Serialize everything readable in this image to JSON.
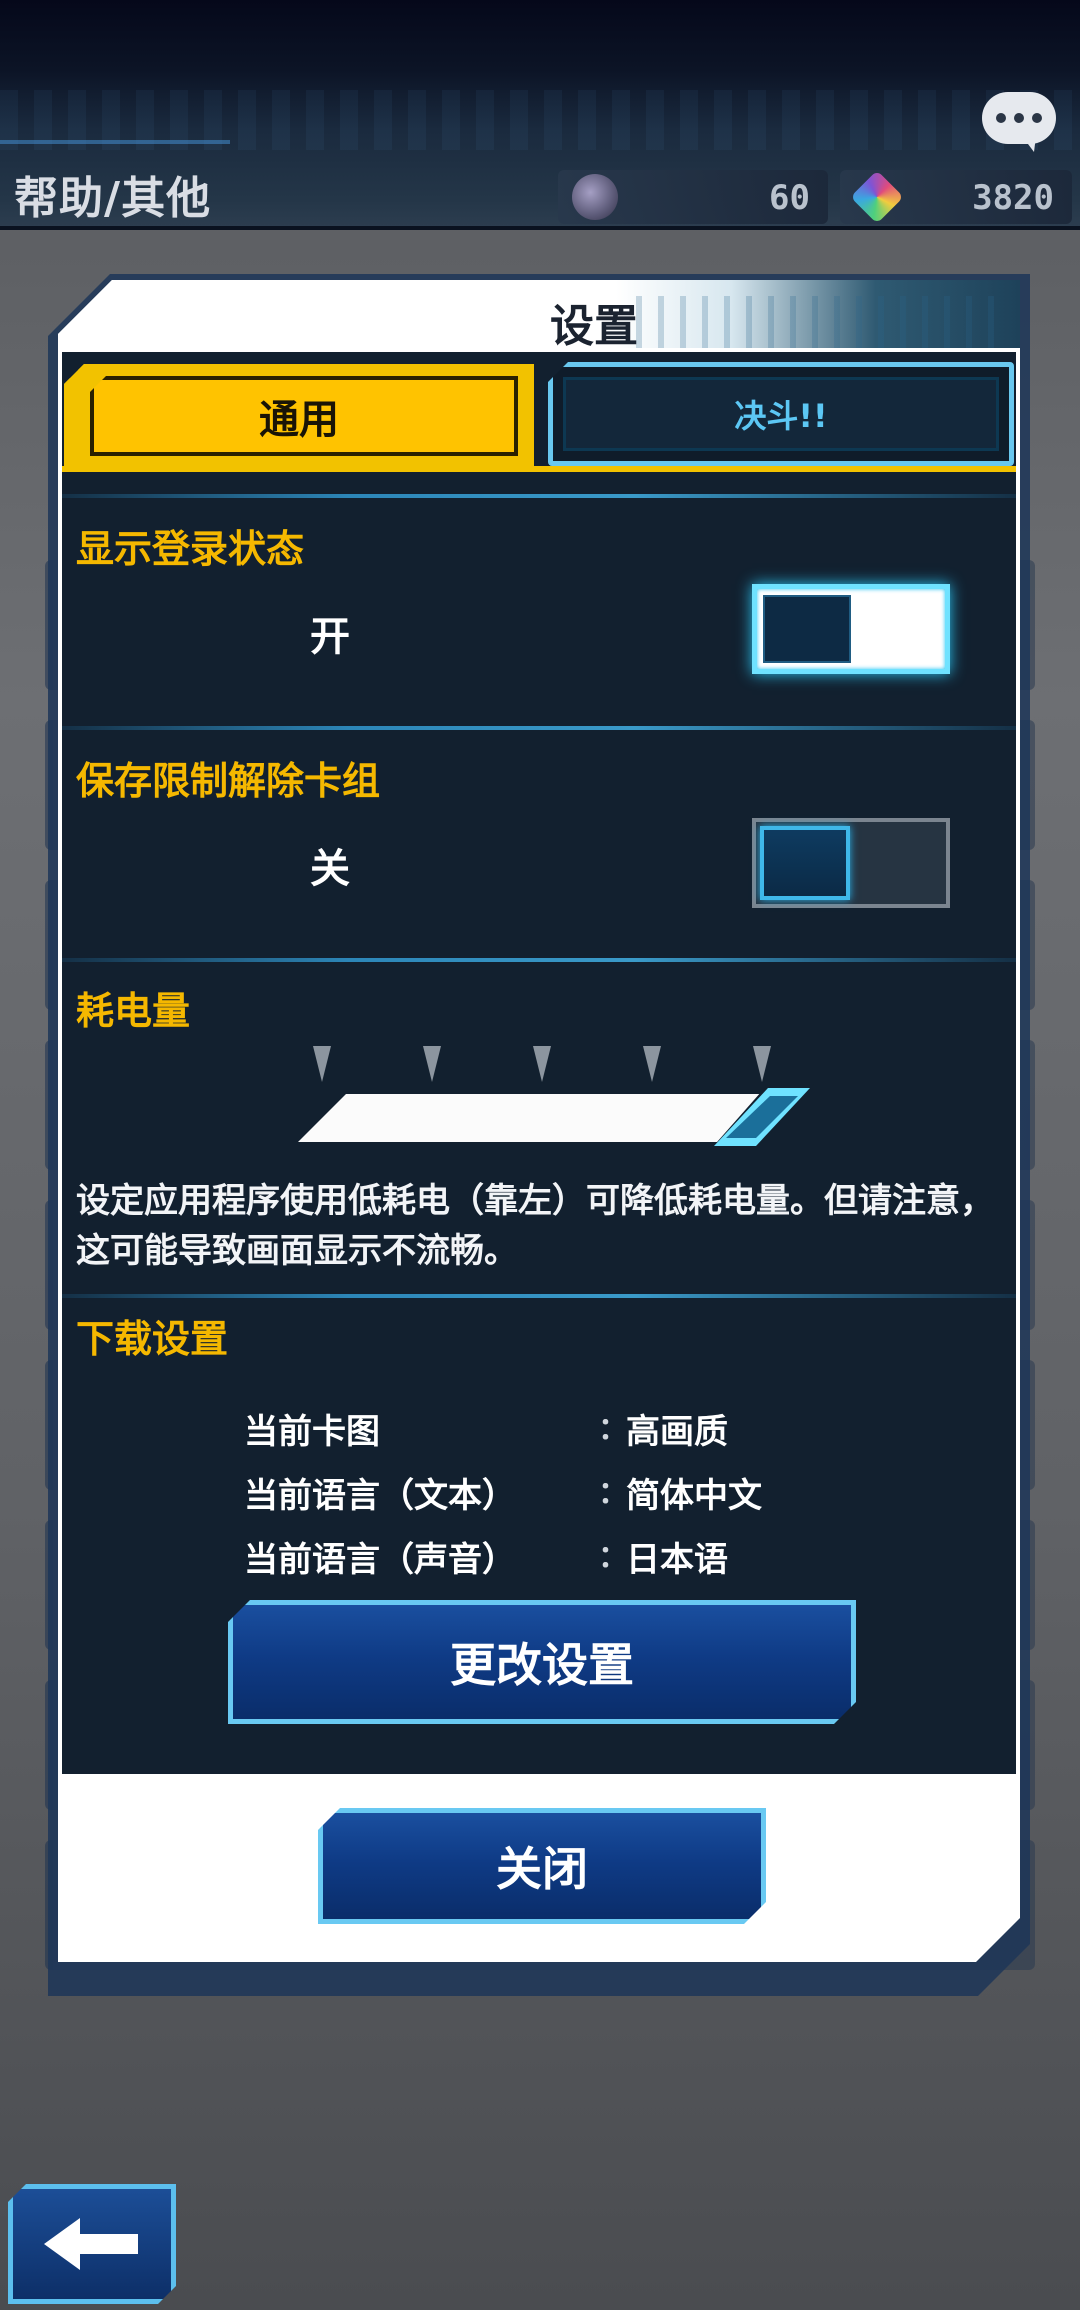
{
  "header": {
    "page_title": "帮助/其他",
    "currencies": [
      {
        "name": "orb",
        "value": "60"
      },
      {
        "name": "gem",
        "value": "3820"
      }
    ],
    "chat_icon": "speech-bubble-icon"
  },
  "dialog": {
    "title": "设置",
    "tabs": [
      {
        "label": "通用",
        "active": true
      },
      {
        "label": "决斗!!",
        "active": false
      }
    ],
    "sections": {
      "login_status": {
        "title": "显示登录状态",
        "state": "开",
        "on": true
      },
      "save_deck": {
        "title": "保存限制解除卡组",
        "state": "关",
        "on": false
      },
      "power": {
        "title": "耗电量",
        "level": 1.0,
        "note": "设定应用程序使用低耗电（靠左）可降低耗电量。但请注意，这可能导致画面显示不流畅。"
      },
      "download": {
        "title": "下载设置",
        "rows": [
          {
            "key": "当前卡图",
            "value": "高画质"
          },
          {
            "key": "当前语言（文本）",
            "value": "简体中文"
          },
          {
            "key": "当前语言（声音）",
            "value": "日本语"
          }
        ],
        "colon": "：",
        "change_button": "更改设置"
      }
    },
    "close_button": "关闭"
  },
  "footer": {
    "back_icon": "arrow-left-icon"
  },
  "colors": {
    "accent_yellow": "#f5b800",
    "accent_cyan": "#6fe2ff",
    "panel_bg": "#12202f"
  }
}
